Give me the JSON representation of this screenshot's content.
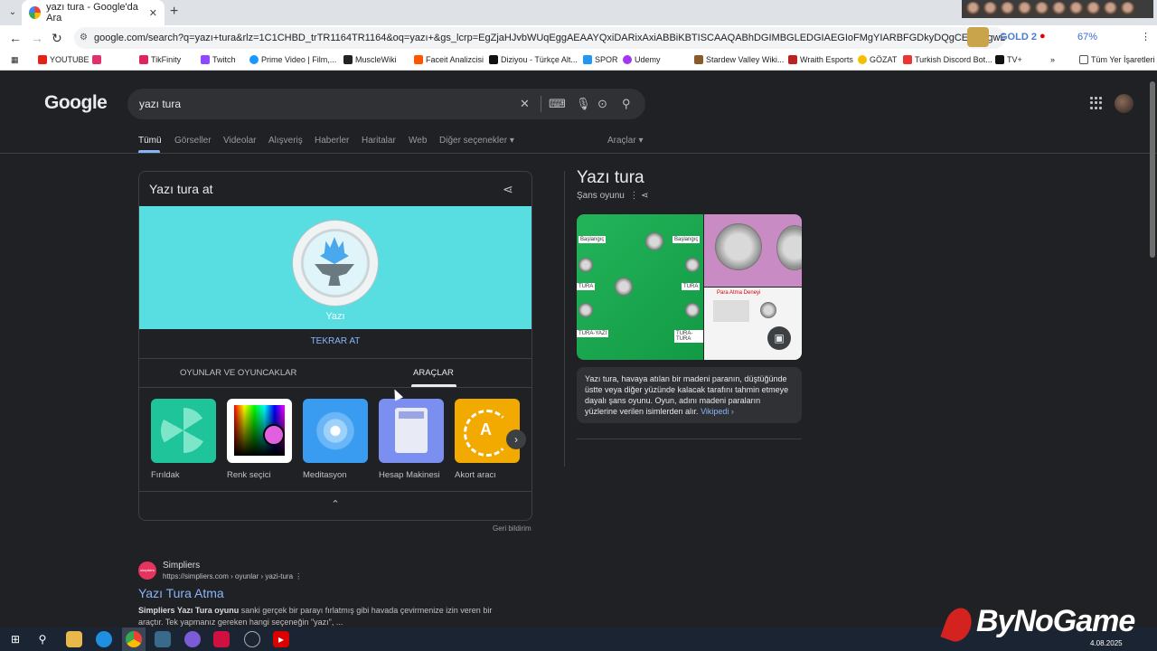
{
  "browser": {
    "tab_title": "yazı tura - Google'da Ara",
    "url": "google.com/search?q=yazı+tura&rlz=1C1CHBD_trTR1164TR1164&oq=yazı+&gs_lcrp=EgZjaHJvbWUqEggAEAAYQxiDARixAxiABBiKBTISCAAQABhDGIMBGLEDGIAEGIoFMgYIARBFGDkyDQgCEAAYgwEYsQMYgAQyDQgDEAAYgwEYsQMYgwg...",
    "extension_badge": "GOLD 2",
    "percent": "67%",
    "bookmarks": [
      {
        "label": "YOUTUBE",
        "color": "#e62117"
      },
      {
        "label": "",
        "color": "#e1306c"
      },
      {
        "label": "TikFinity",
        "color": "#e0245e"
      },
      {
        "label": "Twitch",
        "color": "#9146ff"
      },
      {
        "label": "Prime Video | Film,...",
        "color": "#1a98ff"
      },
      {
        "label": "MuscleWiki",
        "color": "#222"
      },
      {
        "label": "Faceit Analizcisi",
        "color": "#ff5500"
      },
      {
        "label": "Diziyou - Türkçe Alt...",
        "color": "#111"
      },
      {
        "label": "SPOR",
        "color": "#2196f3"
      },
      {
        "label": "Udemy",
        "color": "#a435f0"
      },
      {
        "label": "Stardew Valley Wiki...",
        "color": "#8b5a2b"
      },
      {
        "label": "Wraith Esports",
        "color": "#b22"
      },
      {
        "label": "GÖZAT",
        "color": "#f5c000"
      },
      {
        "label": "Turkish Discord Bot...",
        "color": "#e33"
      },
      {
        "label": "TV+",
        "color": "#111"
      },
      {
        "label": "Tüm Yer İşaretleri",
        "color": "#555"
      }
    ]
  },
  "google": {
    "logo": "Google",
    "query": "yazı tura",
    "nav_tabs": [
      "Tümü",
      "Görseller",
      "Videolar",
      "Alışveriş",
      "Haberler",
      "Haritalar",
      "Web",
      "Diğer seçenekler ▾"
    ],
    "tools_label": "Araçlar ▾"
  },
  "coin_card": {
    "title": "Yazı tura at",
    "result": "Yazı",
    "again": "TEKRAR AT",
    "tabs": [
      "OYUNLAR VE OYUNCAKLAR",
      "ARAÇLAR"
    ],
    "tools": [
      {
        "label": "Fırıldak",
        "color": "#1fc49a"
      },
      {
        "label": "Renk seçici",
        "color": "#ffffff"
      },
      {
        "label": "Meditasyon",
        "color": "#3a9cf0"
      },
      {
        "label": "Hesap Makinesi",
        "color": "#7b8ff0"
      },
      {
        "label": "Akort aracı",
        "color": "#f2a900"
      }
    ],
    "feedback": "Geri bildirim"
  },
  "result": {
    "site": "Simpliers",
    "favicon_text": "simpliers",
    "url": "https://simpliers.com › oyunlar › yazi-tura",
    "title": "Yazı Tura Atma",
    "snippet_bold": "Simpliers Yazı Tura oyunu",
    "snippet": " sanki gerçek bir parayı fırlatmış gibi havada çevirmenize izin veren bir araçtır. Tek yapmanız gereken hangi seçeneğin \"yazı\", ..."
  },
  "knowledge": {
    "title": "Yazı tura",
    "subtitle": "Şans oyunu",
    "image_labels": [
      "Başlangıç",
      "Başlangıç",
      "TURA",
      "TURA",
      "TURA-YAZI",
      "TURA-TURA",
      "Para Atma Deneyi"
    ],
    "description": "Yazı tura, havaya atılan bir madeni paranın, düştüğünde üstte veya diğer yüzünde kalacak tarafını tahmin etmeye dayalı şans oyunu. Oyun, adını madeni paraların yüzlerine verilen isimlerden alır.",
    "source_link": "Vikipedi ›"
  },
  "taskbar": {
    "watermark": "ByNoGame",
    "date": "4.08.2025"
  }
}
